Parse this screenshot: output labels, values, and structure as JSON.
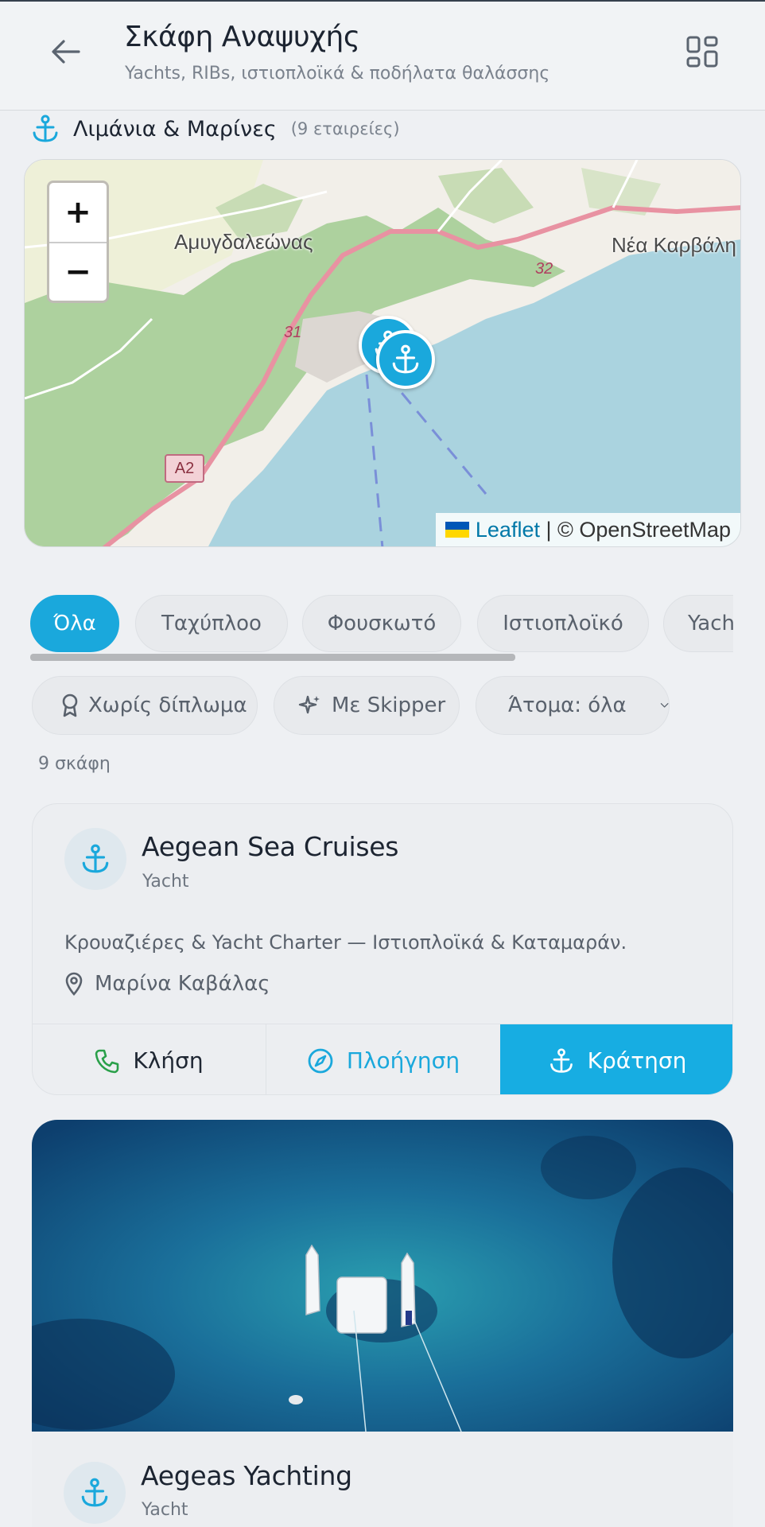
{
  "header": {
    "title": "Σκάφη Αναψυχής",
    "subtitle": "Yachts, RIBs, ιστιοπλοϊκά & ποδήλατα θαλάσσης"
  },
  "section": {
    "title": "Λιμάνια & Μαρίνες",
    "count": "(9 εταιρείες)"
  },
  "map": {
    "zoom_in": "+",
    "zoom_out": "−",
    "labels": {
      "place1": "Αμυγδαλεώνας",
      "place2": "Νέα Καρβάλη",
      "road31": "31",
      "road32": "32",
      "roadA2": "A2"
    },
    "attribution": {
      "leaflet": "Leaflet",
      "separator": " | © ",
      "osm": "OpenStreetMap"
    },
    "colors": {
      "land": "#f2efe9",
      "forest": "#add19e",
      "water": "#aad3df",
      "marker": "#1aa8dc"
    }
  },
  "categories": [
    "Όλα",
    "Ταχύπλοο",
    "Φουσκωτό",
    "Ιστιοπλοϊκό",
    "Yacht"
  ],
  "filters": {
    "no_license": "Χωρίς δίπλωμα",
    "with_skipper": "Με Skipper",
    "people": "Άτομα: όλα"
  },
  "results_count": "9 σκάφη",
  "cards": [
    {
      "name": "Aegean Sea Cruises",
      "type": "Yacht",
      "description": "Κρουαζιέρες & Yacht Charter — Ιστιοπλοϊκά & Καταμαράν.",
      "location": "Μαρίνα Καβάλας",
      "actions": {
        "call": "Κλήση",
        "navigate": "Πλοήγηση",
        "book": "Κράτηση"
      }
    },
    {
      "name": "Aegeas Yachting",
      "type": "Yacht"
    }
  ],
  "accent_color": "#1aa8dc"
}
